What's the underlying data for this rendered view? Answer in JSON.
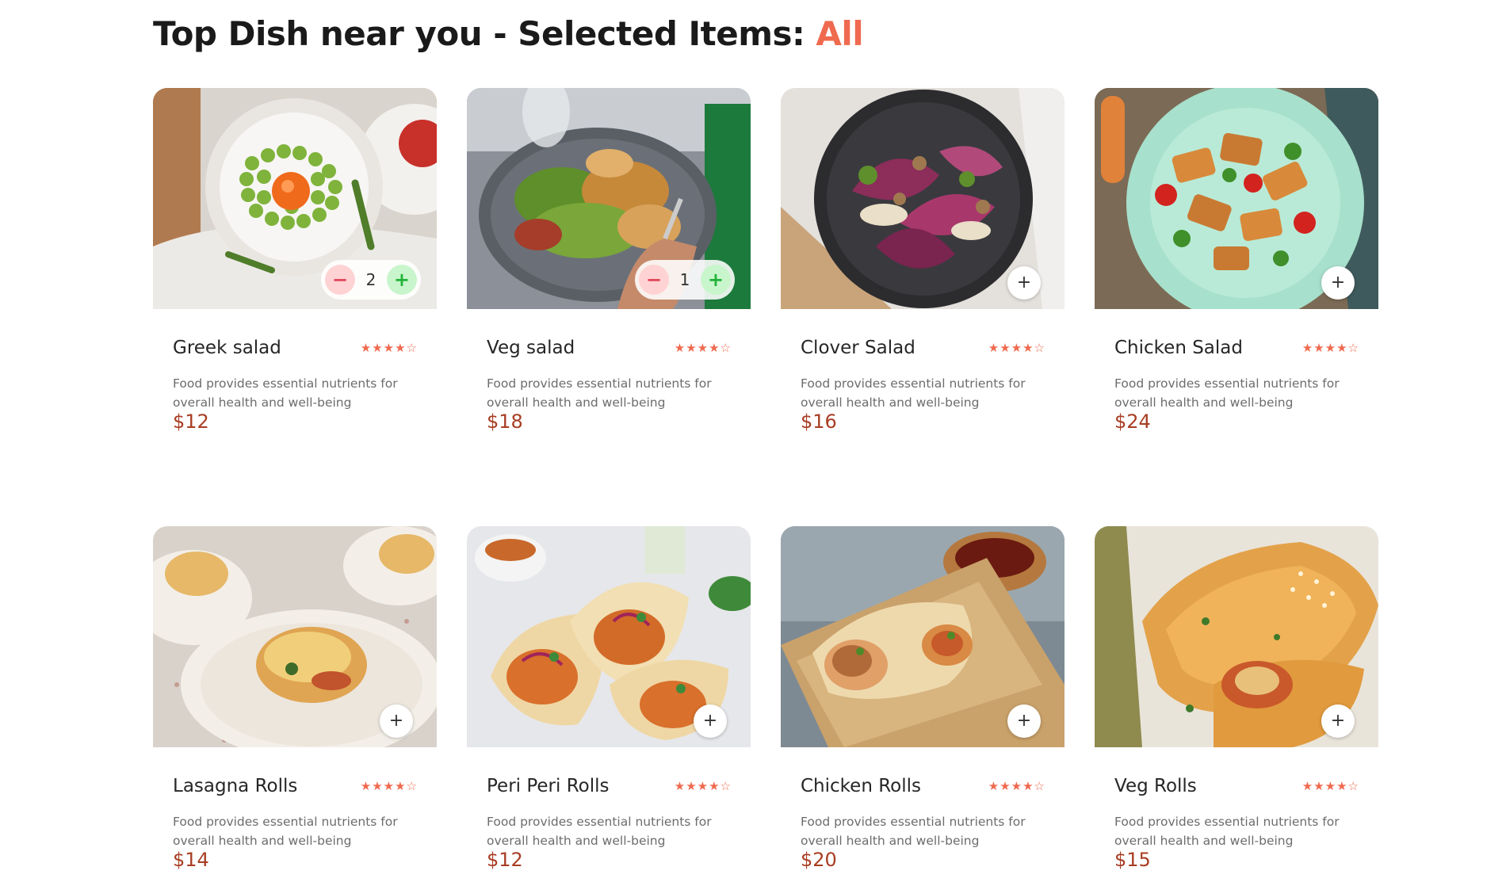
{
  "heading": {
    "text": "Top Dish near you - Selected Items: ",
    "accent": "All"
  },
  "accent_color": "#ef6a4f",
  "price_color": "#a83d23",
  "cards": [
    {
      "name": "Greek salad",
      "rating": 4,
      "description": "Food provides essential nutrients for overall health and well-being",
      "price": "$12",
      "quantity": "2",
      "has_counter": true
    },
    {
      "name": "Veg salad",
      "rating": 4,
      "description": "Food provides essential nutrients for overall health and well-being",
      "price": "$18",
      "quantity": "1",
      "has_counter": true
    },
    {
      "name": "Clover Salad",
      "rating": 4,
      "description": "Food provides essential nutrients for overall health and well-being",
      "price": "$16",
      "has_counter": false,
      "add_label": "+"
    },
    {
      "name": "Chicken Salad",
      "rating": 4,
      "description": "Food provides essential nutrients for overall health and well-being",
      "price": "$24",
      "has_counter": false,
      "add_label": "+"
    },
    {
      "name": "Lasagna Rolls",
      "rating": 4,
      "description": "Food provides essential nutrients for overall health and well-being",
      "price": "$14",
      "has_counter": false,
      "add_label": "+"
    },
    {
      "name": "Peri Peri Rolls",
      "rating": 4,
      "description": "Food provides essential nutrients for overall health and well-being",
      "price": "$12",
      "has_counter": false,
      "add_label": "+"
    },
    {
      "name": "Chicken Rolls",
      "rating": 4,
      "description": "Food provides essential nutrients for overall health and well-being",
      "price": "$20",
      "has_counter": false,
      "add_label": "+"
    },
    {
      "name": "Veg Rolls",
      "rating": 4,
      "description": "Food provides essential nutrients for overall health and well-being",
      "price": "$15",
      "has_counter": false,
      "add_label": "+"
    }
  ],
  "counter_labels": {
    "minus": "−",
    "plus": "+"
  },
  "icons": {
    "star_full": "★",
    "star_empty": "☆"
  }
}
